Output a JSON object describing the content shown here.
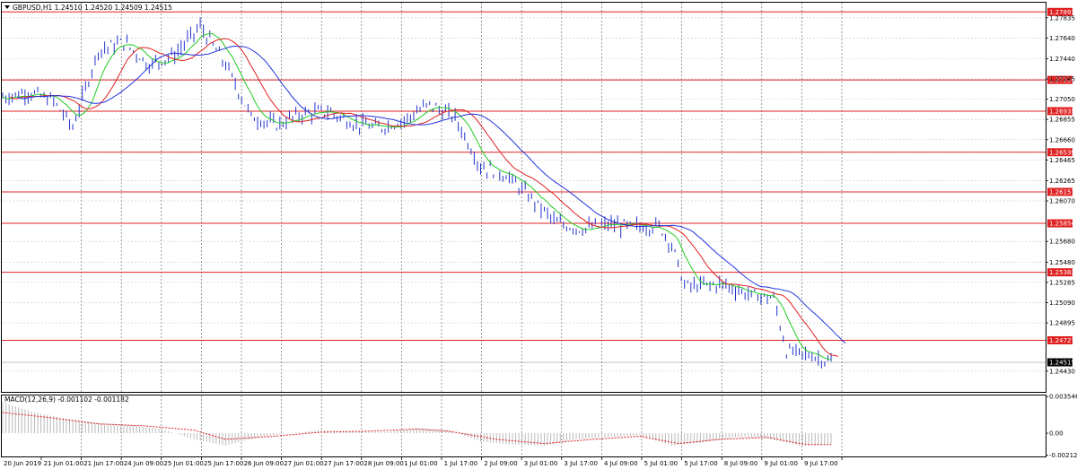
{
  "header": {
    "symbol_title": "GBPUSD,H1  1.24510 1.24520 1.24509 1.24515",
    "macd_title": "MACD(12,26,9) -0.001102 -0.001182"
  },
  "chart_data": {
    "type": "line",
    "title": "GBPUSD,H1  1.24510 1.24520 1.24509 1.24515",
    "colors": {
      "price": "#2233cc",
      "grid": "#c8c8c8",
      "ma_fast": "#22cc22",
      "ma_mid": "#e02020",
      "ma_slow": "#2233dd",
      "level": "#e02020",
      "macd_hist": "#b8b8b8",
      "macd_signal": "#e02020"
    },
    "price_axis_ticks": [
      "1.27835",
      "1.27640",
      "1.27440",
      "1.27245",
      "1.27050",
      "1.26855",
      "1.26660",
      "1.26465",
      "1.26265",
      "1.26070",
      "1.25680",
      "1.25480",
      "1.25285",
      "1.25090",
      "1.24895",
      "1.24430"
    ],
    "ylim": [
      1.2423,
      1.2798
    ],
    "horizontal_levels": [
      {
        "label": "1.27891",
        "value": 1.27891
      },
      {
        "label": "1.27236",
        "value": 1.27236
      },
      {
        "label": "1.26935",
        "value": 1.26935
      },
      {
        "label": "1.26539",
        "value": 1.26539
      },
      {
        "label": "1.26157",
        "value": 1.26157
      },
      {
        "label": "1.25854",
        "value": 1.25854
      },
      {
        "label": "1.25382",
        "value": 1.25382
      },
      {
        "label": "1.24727",
        "value": 1.24727
      }
    ],
    "current_price": {
      "label": "1.24515",
      "value": 1.24515
    },
    "time_labels": [
      "20 Jun 2019",
      "21 Jun 01:00",
      "21 Jun 17:00",
      "24 Jun 09:00",
      "25 Jun 01:00",
      "25 Jun 17:00",
      "26 Jun 09:00",
      "27 Jun 01:00",
      "27 Jun 17:00",
      "28 Jun 09:00",
      "1 Jul 01:00",
      "1 Jul 17:00",
      "2 Jul 09:00",
      "3 Jul 01:00",
      "3 Jul 17:00",
      "4 Jul 09:00",
      "5 Jul 01:00",
      "5 Jul 17:00",
      "8 Jul 09:00",
      "9 Jul 01:00",
      "9 Jul 17:00"
    ],
    "price_series": [
      {
        "bar": 0,
        "y": 1.2707
      },
      {
        "bar": 8,
        "y": 1.2712
      },
      {
        "bar": 16,
        "y": 1.2703
      },
      {
        "bar": 22,
        "y": 1.2678
      },
      {
        "bar": 30,
        "y": 1.2752
      },
      {
        "bar": 38,
        "y": 1.276
      },
      {
        "bar": 46,
        "y": 1.2738
      },
      {
        "bar": 54,
        "y": 1.2748
      },
      {
        "bar": 62,
        "y": 1.2775
      },
      {
        "bar": 70,
        "y": 1.2738
      },
      {
        "bar": 78,
        "y": 1.2688
      },
      {
        "bar": 86,
        "y": 1.268
      },
      {
        "bar": 94,
        "y": 1.2691
      },
      {
        "bar": 102,
        "y": 1.2693
      },
      {
        "bar": 110,
        "y": 1.2682
      },
      {
        "bar": 118,
        "y": 1.2677
      },
      {
        "bar": 126,
        "y": 1.2685
      },
      {
        "bar": 134,
        "y": 1.27
      },
      {
        "bar": 142,
        "y": 1.2687
      },
      {
        "bar": 150,
        "y": 1.264
      },
      {
        "bar": 158,
        "y": 1.2632
      },
      {
        "bar": 166,
        "y": 1.2609
      },
      {
        "bar": 174,
        "y": 1.2585
      },
      {
        "bar": 182,
        "y": 1.258
      },
      {
        "bar": 190,
        "y": 1.2584
      },
      {
        "bar": 198,
        "y": 1.2582
      },
      {
        "bar": 206,
        "y": 1.2583
      },
      {
        "bar": 210,
        "y": 1.2565
      },
      {
        "bar": 214,
        "y": 1.2525
      },
      {
        "bar": 218,
        "y": 1.2525
      },
      {
        "bar": 226,
        "y": 1.2527
      },
      {
        "bar": 234,
        "y": 1.2517
      },
      {
        "bar": 242,
        "y": 1.2513
      },
      {
        "bar": 246,
        "y": 1.2462
      },
      {
        "bar": 254,
        "y": 1.2458
      },
      {
        "bar": 260,
        "y": 1.24515
      }
    ],
    "macd": {
      "title": "MACD(12,26,9) -0.001102 -0.001182",
      "ticks": [
        "0.003546",
        "0.00",
        "-0.002121"
      ],
      "ylim": [
        -0.00225,
        0.00365
      ],
      "histogram": [
        {
          "bar": 0,
          "v": 0.003
        },
        {
          "bar": 10,
          "v": 0.002
        },
        {
          "bar": 20,
          "v": 0.0014
        },
        {
          "bar": 30,
          "v": 0.001
        },
        {
          "bar": 40,
          "v": 0.0008
        },
        {
          "bar": 50,
          "v": 0.0004
        },
        {
          "bar": 60,
          "v": -0.0006
        },
        {
          "bar": 70,
          "v": -0.0012
        },
        {
          "bar": 80,
          "v": -0.0004
        },
        {
          "bar": 90,
          "v": 0.0
        },
        {
          "bar": 100,
          "v": 0.0003
        },
        {
          "bar": 110,
          "v": 0.0002
        },
        {
          "bar": 120,
          "v": 0.0001
        },
        {
          "bar": 130,
          "v": 0.0005
        },
        {
          "bar": 140,
          "v": 0.0003
        },
        {
          "bar": 150,
          "v": -0.0008
        },
        {
          "bar": 160,
          "v": -0.0011
        },
        {
          "bar": 170,
          "v": -0.0012
        },
        {
          "bar": 180,
          "v": -0.0006
        },
        {
          "bar": 190,
          "v": -0.0004
        },
        {
          "bar": 200,
          "v": -0.0002
        },
        {
          "bar": 210,
          "v": -0.0012
        },
        {
          "bar": 220,
          "v": -0.0009
        },
        {
          "bar": 230,
          "v": -0.0004
        },
        {
          "bar": 240,
          "v": -0.0005
        },
        {
          "bar": 250,
          "v": -0.0012
        },
        {
          "bar": 260,
          "v": -0.0011
        }
      ],
      "signal": [
        {
          "bar": 0,
          "v": 0.002
        },
        {
          "bar": 15,
          "v": 0.0015
        },
        {
          "bar": 30,
          "v": 0.0009
        },
        {
          "bar": 45,
          "v": 0.0007
        },
        {
          "bar": 60,
          "v": 0.0003
        },
        {
          "bar": 70,
          "v": -0.0006
        },
        {
          "bar": 85,
          "v": -0.0003
        },
        {
          "bar": 100,
          "v": 0.0001
        },
        {
          "bar": 115,
          "v": 0.0002
        },
        {
          "bar": 130,
          "v": 0.0004
        },
        {
          "bar": 140,
          "v": 0.0002
        },
        {
          "bar": 155,
          "v": -0.0006
        },
        {
          "bar": 170,
          "v": -0.001
        },
        {
          "bar": 185,
          "v": -0.0006
        },
        {
          "bar": 200,
          "v": -0.0003
        },
        {
          "bar": 212,
          "v": -0.001
        },
        {
          "bar": 225,
          "v": -0.0006
        },
        {
          "bar": 240,
          "v": -0.0004
        },
        {
          "bar": 252,
          "v": -0.0011
        },
        {
          "bar": 260,
          "v": -0.0011
        }
      ]
    }
  }
}
